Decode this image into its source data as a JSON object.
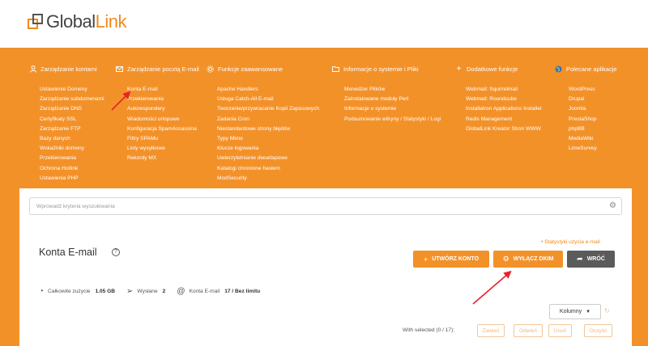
{
  "brand": {
    "name_part1": "Global",
    "name_part2": "Link"
  },
  "menu": [
    {
      "heading": "Zarządzanie kontami",
      "icon": "user-icon",
      "items": [
        "Ustawienie Domeny",
        "Zarządzanie subdomenami",
        "Zarządzanie DNS",
        "Certyfikaty SSL",
        "Zarządzanie FTP",
        "Bazy danych",
        "Wskaźniki domeny",
        "Przekierowania",
        "Ochrona Hotlink",
        "Ustawienia PHP"
      ]
    },
    {
      "heading": "Zarządzanie pocztą E-mail",
      "icon": "envelope-icon",
      "items": [
        "Konta E-mail",
        "Przekierowania",
        "Autorespondery",
        "Wiadomości urlopowe",
        "Konfiguracja SpamAssassina",
        "Filtry SPAMu",
        "Listy wysyłkowe",
        "Rekordy MX"
      ]
    },
    {
      "heading": "Funkcje zaawansowane",
      "icon": "gear-icon",
      "items": [
        "Apache Handlers",
        "Usługa Catch-All E-mail",
        "Tworzenie/przywracanie Kopii Zapasowych",
        "Zadania Cron",
        "Niestandardowe strony błędów",
        "Typy Mime",
        "Klucze logowania",
        "Uwierzytelnianie dwuetapowe",
        "Katalogi chronione hasłem",
        "ModSecurity"
      ]
    },
    {
      "heading": "Informacje o systemie i Pliki",
      "icon": "folder-icon",
      "items": [
        "Menedżer Plików",
        "Zainstalowane moduły Perl",
        "Informacje o systemie",
        "Podsumowanie witryny / Statystyki / Logi"
      ]
    },
    {
      "heading": "Dodatkowe funkcje",
      "icon": "plus-icon",
      "items": [
        "Webmail: Squirrelmail",
        "Webmail: Roundcube",
        "Installatron Applications Installer",
        "Redis Management",
        "GlobalLink Kreator Stron WWW"
      ]
    },
    {
      "heading": "Polecane aplikacje",
      "icon": "globe-icon",
      "items": [
        "WordPress",
        "Drupal",
        "Joomla",
        "PrestaShop",
        "phpBB",
        "MediaWiki",
        "LimeSurvey"
      ]
    }
  ],
  "search": {
    "placeholder": "Wprowadź kryteria wyszukiwania"
  },
  "page": {
    "title": "Konta E-mail",
    "stats_link": "• Statystyki użycia e-mail",
    "buttons": {
      "create": "UTWÓRZ KONTO",
      "dkim": "WYŁĄCZ DKIM",
      "back": "WRÓĆ"
    },
    "stats": {
      "usage_label": "Całkowite zużycie",
      "usage_value": "1.05 GB",
      "sent_label": "Wysłane",
      "sent_value": "2",
      "accounts_label": "Konta E-mail",
      "accounts_value": "17 / Bez limitu"
    },
    "columns_button": "Kolumny",
    "with_selected": "With selected (0 / 17):",
    "actions": {
      "suspend": "Zawieś",
      "unsuspend": "Odwieś",
      "delete": "Usuń",
      "clear": "Oczyść"
    }
  },
  "colors": {
    "accent": "#f39129",
    "dark_button": "#5b5b5b",
    "annotation_arrow": "#e8212b"
  }
}
